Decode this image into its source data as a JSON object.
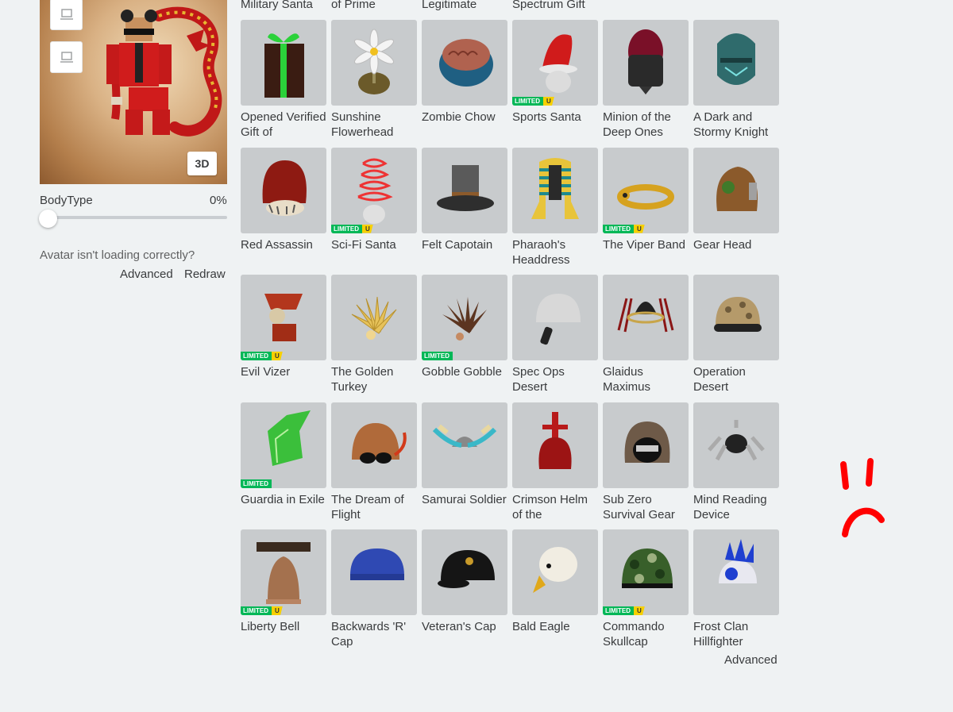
{
  "avatar": {
    "view_button": "3D",
    "bodytype_label": "BodyType",
    "bodytype_value": "0%",
    "bodytype_fraction": 0.0,
    "issue_text": "Avatar isn't loading correctly?",
    "advanced_link": "Advanced",
    "redraw_link": "Redraw"
  },
  "top_row_labels": [
    "Military Santa",
    "of Prime",
    "Legitimate",
    "Spectrum Gift"
  ],
  "items": [
    {
      "name": "Opened Verified Gift of",
      "badge": "",
      "art": "gift"
    },
    {
      "name": "Sunshine Flowerhead",
      "badge": "",
      "art": "flower"
    },
    {
      "name": "Zombie Chow",
      "badge": "",
      "art": "brain"
    },
    {
      "name": "Sports Santa",
      "badge": "limited-u",
      "art": "santa"
    },
    {
      "name": "Minion of the Deep Ones",
      "badge": "",
      "art": "minion"
    },
    {
      "name": "A Dark and Stormy Knight",
      "badge": "",
      "art": "knight"
    },
    {
      "name": "Red Assassin",
      "badge": "",
      "art": "hood"
    },
    {
      "name": "Sci-Fi Santa",
      "badge": "limited-u",
      "art": "scifi"
    },
    {
      "name": "Felt Capotain",
      "badge": "",
      "art": "pilgrim"
    },
    {
      "name": "Pharaoh's Headdress",
      "badge": "",
      "art": "pharaoh"
    },
    {
      "name": "The Viper Band",
      "badge": "limited-u",
      "art": "band"
    },
    {
      "name": "Gear Head",
      "badge": "",
      "art": "gear"
    },
    {
      "name": "Evil Vizer",
      "badge": "limited-u",
      "art": "vizer"
    },
    {
      "name": "The Golden Turkey",
      "badge": "",
      "art": "goldturkey"
    },
    {
      "name": "Gobble Gobble",
      "badge": "limited",
      "art": "turkey"
    },
    {
      "name": "Spec Ops Desert",
      "badge": "",
      "art": "specops"
    },
    {
      "name": "Glaidus Maximus",
      "badge": "",
      "art": "glaidus"
    },
    {
      "name": "Operation Desert",
      "badge": "",
      "art": "desert"
    },
    {
      "name": "Guardia in Exile",
      "badge": "limited",
      "art": "guardia"
    },
    {
      "name": "The Dream of Flight",
      "badge": "",
      "art": "aviator"
    },
    {
      "name": "Samurai Soldier",
      "badge": "",
      "art": "samurai"
    },
    {
      "name": "Crimson Helm of the",
      "badge": "",
      "art": "crimson"
    },
    {
      "name": "Sub Zero Survival Gear",
      "badge": "",
      "art": "subzero"
    },
    {
      "name": "Mind Reading Device",
      "badge": "",
      "art": "mind"
    },
    {
      "name": "Liberty Bell",
      "badge": "limited-u",
      "art": "bell"
    },
    {
      "name": "Backwards 'R' Cap",
      "badge": "",
      "art": "capblue"
    },
    {
      "name": "Veteran's Cap",
      "badge": "",
      "art": "capblack"
    },
    {
      "name": "Bald Eagle",
      "badge": "",
      "art": "eagle"
    },
    {
      "name": "Commando Skullcap",
      "badge": "limited-u",
      "art": "camo"
    },
    {
      "name": "Frost Clan Hillfighter",
      "badge": "",
      "art": "frost"
    }
  ],
  "badge_text": {
    "limited": "LIMITED",
    "u": "U"
  },
  "bottom_advanced_link": "Advanced",
  "colors": {
    "background": "#eff2f3",
    "tile": "#c8cbcd",
    "limited_green": "#02b757",
    "unique_yellow": "#f7d000",
    "annotation_red": "#ff0000"
  }
}
